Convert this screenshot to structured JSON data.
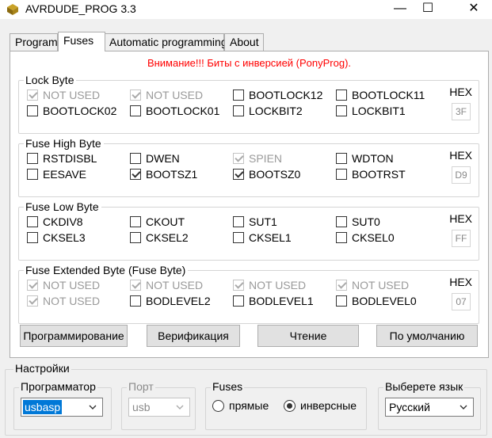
{
  "window": {
    "title": "AVRDUDE_PROG 3.3",
    "minimize": "—",
    "maximize": "☐",
    "close": "✕"
  },
  "tabs": [
    {
      "label": "Program",
      "active": false
    },
    {
      "label": "Fuses",
      "active": true
    },
    {
      "label": "Automatic programming",
      "active": false
    },
    {
      "label": "About",
      "active": false
    }
  ],
  "warning": "Внимание!!! Биты с инверсией (PonyProg).",
  "groups": {
    "lock": {
      "title": "Lock Byte",
      "hex_label": "HEX",
      "hex": "3F",
      "row1": [
        "NOT USED",
        "NOT USED",
        "BOOTLOCK12",
        "BOOTLOCK11"
      ],
      "row2": [
        "BOOTLOCK02",
        "BOOTLOCK01",
        "LOCKBIT2",
        "LOCKBIT1"
      ]
    },
    "high": {
      "title": "Fuse High Byte",
      "hex_label": "HEX",
      "hex": "D9",
      "row1": [
        "RSTDISBL",
        "DWEN",
        "SPIEN",
        "WDTON"
      ],
      "row2": [
        "EESAVE",
        "BOOTSZ1",
        "BOOTSZ0",
        "BOOTRST"
      ]
    },
    "low": {
      "title": "Fuse Low Byte",
      "hex_label": "HEX",
      "hex": "FF",
      "row1": [
        "CKDIV8",
        "CKOUT",
        "SUT1",
        "SUT0"
      ],
      "row2": [
        "CKSEL3",
        "CKSEL2",
        "CKSEL1",
        "CKSEL0"
      ]
    },
    "ext": {
      "title": "Fuse Extended Byte (Fuse Byte)",
      "hex_label": "HEX",
      "hex": "07",
      "row1": [
        "NOT USED",
        "NOT USED",
        "NOT USED",
        "NOT USED"
      ],
      "row2": [
        "NOT USED",
        "BODLEVEL2",
        "BODLEVEL1",
        "BODLEVEL0"
      ]
    }
  },
  "buttons": {
    "program": "Программирование",
    "verify": "Верификация",
    "read": "Чтение",
    "default": "По умолчанию"
  },
  "settings": {
    "title": "Настройки",
    "programmer": {
      "label": "Программатор",
      "value": "usbasp"
    },
    "port": {
      "label": "Порт",
      "value": "usb"
    },
    "fuses": {
      "label": "Fuses",
      "direct": "прямые",
      "inverse": "инверсные",
      "selected": "inverse"
    },
    "language": {
      "label": "Выберете язык",
      "value": "Русский"
    }
  }
}
